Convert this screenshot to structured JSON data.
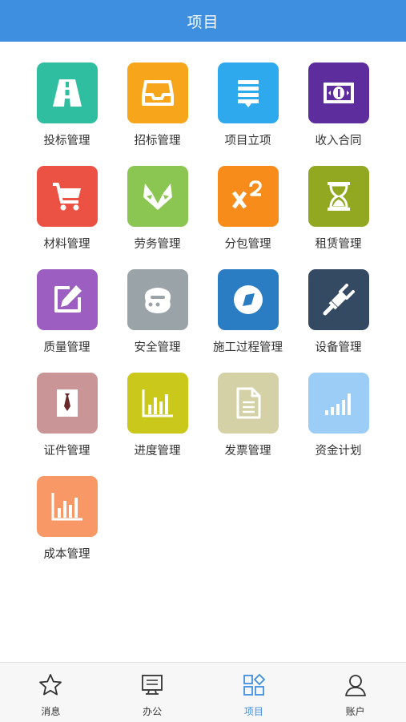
{
  "header": {
    "title": "项目"
  },
  "colors": {
    "header_bg": "#3f8fe0",
    "tab_active": "#3f8fe0",
    "tab_inactive": "#333333"
  },
  "modules": [
    {
      "label": "投标管理",
      "color": "#2fbfa0",
      "icon": "road-icon"
    },
    {
      "label": "招标管理",
      "color": "#f7a61b",
      "icon": "inbox-icon"
    },
    {
      "label": "项目立项",
      "color": "#2fa9ee",
      "icon": "message-list-icon"
    },
    {
      "label": "收入合同",
      "color": "#5d2d9e",
      "icon": "money-icon"
    },
    {
      "label": "材料管理",
      "color": "#ec5244",
      "icon": "cart-icon"
    },
    {
      "label": "劳务管理",
      "color": "#8cc652",
      "icon": "fox-icon"
    },
    {
      "label": "分包管理",
      "color": "#f78c1b",
      "icon": "superscript-icon"
    },
    {
      "label": "租赁管理",
      "color": "#92a820",
      "icon": "hourglass-icon"
    },
    {
      "label": "质量管理",
      "color": "#9c5ec0",
      "icon": "edit-icon"
    },
    {
      "label": "安全管理",
      "color": "#9aa3a7",
      "icon": "chat-bot-icon"
    },
    {
      "label": "施工过程管理",
      "color": "#2a7cc3",
      "icon": "compass-icon"
    },
    {
      "label": "设备管理",
      "color": "#344a63",
      "icon": "plug-icon"
    },
    {
      "label": "证件管理",
      "color": "#c99597",
      "icon": "id-card-icon"
    },
    {
      "label": "进度管理",
      "color": "#c9c81b",
      "icon": "bar-chart-icon"
    },
    {
      "label": "发票管理",
      "color": "#d3d1a5",
      "icon": "document-icon"
    },
    {
      "label": "资金计划",
      "color": "#9ccdf6",
      "icon": "signal-icon"
    },
    {
      "label": "成本管理",
      "color": "#f89866",
      "icon": "bar-chart-icon"
    }
  ],
  "tabs": [
    {
      "label": "消息",
      "icon": "star-icon",
      "active": false
    },
    {
      "label": "办公",
      "icon": "monitor-icon",
      "active": false
    },
    {
      "label": "项目",
      "icon": "apps-icon",
      "active": true
    },
    {
      "label": "账户",
      "icon": "user-icon",
      "active": false
    }
  ]
}
